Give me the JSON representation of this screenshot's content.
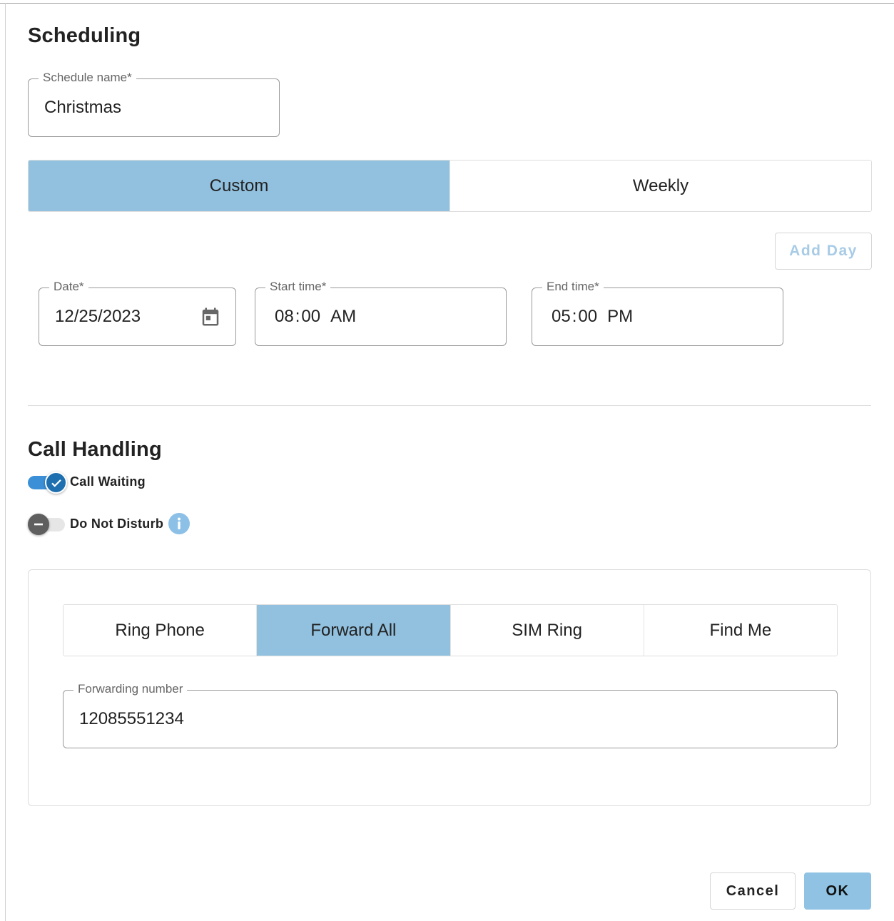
{
  "scheduling": {
    "title": "Scheduling",
    "schedule_name": {
      "label": "Schedule name*",
      "value": "Christmas"
    },
    "mode_tabs": [
      {
        "label": "Custom",
        "selected": true
      },
      {
        "label": "Weekly",
        "selected": false
      }
    ],
    "add_day_label": "Add Day",
    "date": {
      "label": "Date*",
      "value": "12/25/2023",
      "icon": "calendar-icon"
    },
    "start_time": {
      "label": "Start time*",
      "hour": "08",
      "sep": ":",
      "minute": "00",
      "ampm": "AM"
    },
    "end_time": {
      "label": "End time*",
      "hour": "05",
      "sep": ":",
      "minute": "00",
      "ampm": "PM"
    }
  },
  "call_handling": {
    "title": "Call Handling",
    "call_waiting": {
      "label": "Call Waiting",
      "enabled": true
    },
    "do_not_disturb": {
      "label": "Do Not Disturb",
      "enabled": false,
      "info_icon": "info-icon"
    },
    "routing_tabs": [
      {
        "label": "Ring Phone",
        "selected": false
      },
      {
        "label": "Forward All",
        "selected": true
      },
      {
        "label": "SIM Ring",
        "selected": false
      },
      {
        "label": "Find Me",
        "selected": false
      }
    ],
    "forwarding_number": {
      "label": "Forwarding number",
      "value": "12085551234"
    }
  },
  "actions": {
    "cancel_label": "Cancel",
    "ok_label": "OK"
  },
  "colors": {
    "accent": "#91c1df",
    "switch_on_thumb": "#1e6fb0",
    "switch_on_track": "#3b8fd6",
    "switch_off_thumb": "#5f5f5f",
    "info": "#8cc0e6",
    "add_day_text": "#a8cbe6"
  }
}
